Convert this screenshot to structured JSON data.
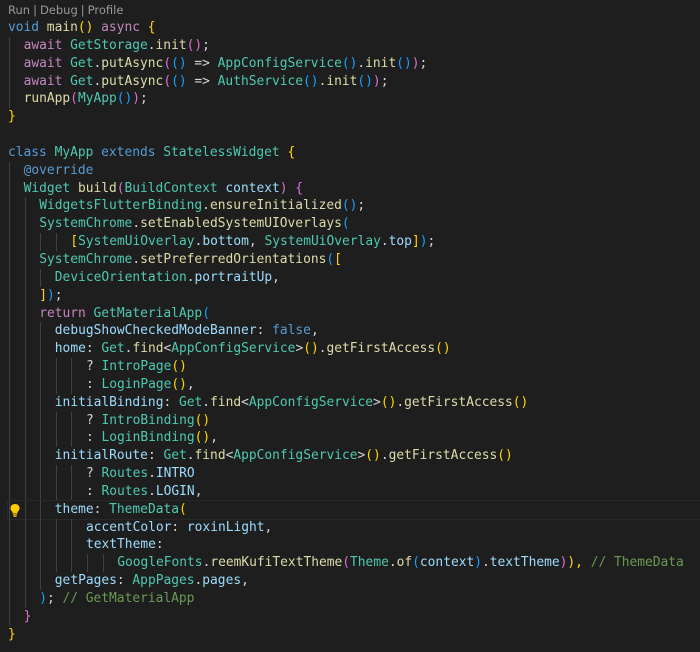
{
  "codelens": {
    "items": [
      "Run",
      "Debug",
      "Profile"
    ],
    "separator": "|"
  },
  "colors": {
    "background": "#1e1e1e",
    "keyword": "#569cd6",
    "control_keyword": "#c586c0",
    "function": "#dcdcaa",
    "type": "#4ec9b0",
    "variable": "#9cdcfe",
    "comment": "#6a9955",
    "bracket_gold": "#ffd700",
    "bracket_orchid": "#da70d6",
    "bracket_blue": "#179fff",
    "lightbulb": "#ffcc00"
  },
  "lightbulb_icon": "lightbulb-icon",
  "lightbulb_line": 28,
  "lines": [
    {
      "indent": 0,
      "tokens": [
        [
          "kw",
          "void"
        ],
        [
          "",
          ""
        ],
        [
          "fn",
          " main"
        ],
        [
          "br1",
          "()"
        ],
        [
          "op",
          " "
        ],
        [
          "ctl",
          "async"
        ],
        [
          "op",
          " "
        ],
        [
          "br1",
          "{"
        ]
      ]
    },
    {
      "indent": 1,
      "tokens": [
        [
          "ctl",
          "await"
        ],
        [
          "op",
          " "
        ],
        [
          "ty",
          "GetStorage"
        ],
        [
          "op",
          "."
        ],
        [
          "fn",
          "init"
        ],
        [
          "br2",
          "()"
        ],
        [
          "op",
          ";"
        ]
      ]
    },
    {
      "indent": 1,
      "tokens": [
        [
          "ctl",
          "await"
        ],
        [
          "op",
          " "
        ],
        [
          "ty",
          "Get"
        ],
        [
          "op",
          "."
        ],
        [
          "fn",
          "putAsync"
        ],
        [
          "br2",
          "("
        ],
        [
          "br3",
          "()"
        ],
        [
          "op",
          " => "
        ],
        [
          "ty",
          "AppConfigService"
        ],
        [
          "br3",
          "()"
        ],
        [
          "op",
          "."
        ],
        [
          "fn",
          "init"
        ],
        [
          "br3",
          "()"
        ],
        [
          "br2",
          ")"
        ],
        [
          "op",
          ";"
        ]
      ]
    },
    {
      "indent": 1,
      "tokens": [
        [
          "ctl",
          "await"
        ],
        [
          "op",
          " "
        ],
        [
          "ty",
          "Get"
        ],
        [
          "op",
          "."
        ],
        [
          "fn",
          "putAsync"
        ],
        [
          "br2",
          "("
        ],
        [
          "br3",
          "()"
        ],
        [
          "op",
          " => "
        ],
        [
          "ty",
          "AuthService"
        ],
        [
          "br3",
          "()"
        ],
        [
          "op",
          "."
        ],
        [
          "fn",
          "init"
        ],
        [
          "br3",
          "()"
        ],
        [
          "br2",
          ")"
        ],
        [
          "op",
          ";"
        ]
      ]
    },
    {
      "indent": 1,
      "tokens": [
        [
          "fn",
          "runApp"
        ],
        [
          "br2",
          "("
        ],
        [
          "ty",
          "MyApp"
        ],
        [
          "br3",
          "()"
        ],
        [
          "br2",
          ")"
        ],
        [
          "op",
          ";"
        ]
      ]
    },
    {
      "indent": 0,
      "tokens": [
        [
          "br1",
          "}"
        ]
      ]
    },
    {
      "indent": 0,
      "tokens": []
    },
    {
      "indent": 0,
      "tokens": [
        [
          "kw",
          "class"
        ],
        [
          "op",
          " "
        ],
        [
          "ty",
          "MyApp"
        ],
        [
          "op",
          " "
        ],
        [
          "kw",
          "extends"
        ],
        [
          "op",
          " "
        ],
        [
          "ty",
          "StatelessWidget"
        ],
        [
          "op",
          " "
        ],
        [
          "br1",
          "{"
        ]
      ]
    },
    {
      "indent": 1,
      "tokens": [
        [
          "kw",
          "@override"
        ]
      ]
    },
    {
      "indent": 1,
      "tokens": [
        [
          "ty",
          "Widget"
        ],
        [
          "op",
          " "
        ],
        [
          "fn",
          "build"
        ],
        [
          "br2",
          "("
        ],
        [
          "ty",
          "BuildContext"
        ],
        [
          "op",
          " "
        ],
        [
          "var",
          "context"
        ],
        [
          "br2",
          ")"
        ],
        [
          "op",
          " "
        ],
        [
          "br2",
          "{"
        ]
      ]
    },
    {
      "indent": 2,
      "tokens": [
        [
          "ty",
          "WidgetsFlutterBinding"
        ],
        [
          "op",
          "."
        ],
        [
          "fn",
          "ensureInitialized"
        ],
        [
          "br3",
          "()"
        ],
        [
          "op",
          ";"
        ]
      ]
    },
    {
      "indent": 2,
      "tokens": [
        [
          "ty",
          "SystemChrome"
        ],
        [
          "op",
          "."
        ],
        [
          "fn",
          "setEnabledSystemUIOverlays"
        ],
        [
          "br3",
          "("
        ]
      ]
    },
    {
      "indent": 4,
      "tokens": [
        [
          "br1",
          "["
        ],
        [
          "ty",
          "SystemUiOverlay"
        ],
        [
          "op",
          "."
        ],
        [
          "var",
          "bottom"
        ],
        [
          "op",
          ", "
        ],
        [
          "ty",
          "SystemUiOverlay"
        ],
        [
          "op",
          "."
        ],
        [
          "var",
          "top"
        ],
        [
          "br1",
          "]"
        ],
        [
          "br3",
          ")"
        ],
        [
          "op",
          ";"
        ]
      ]
    },
    {
      "indent": 2,
      "tokens": [
        [
          "ty",
          "SystemChrome"
        ],
        [
          "op",
          "."
        ],
        [
          "fn",
          "setPreferredOrientations"
        ],
        [
          "br3",
          "("
        ],
        [
          "br1",
          "["
        ]
      ]
    },
    {
      "indent": 3,
      "tokens": [
        [
          "ty",
          "DeviceOrientation"
        ],
        [
          "op",
          "."
        ],
        [
          "var",
          "portraitUp"
        ],
        [
          "op",
          ","
        ]
      ]
    },
    {
      "indent": 2,
      "tokens": [
        [
          "br1",
          "]"
        ],
        [
          "br3",
          ")"
        ],
        [
          "op",
          ";"
        ]
      ]
    },
    {
      "indent": 2,
      "tokens": [
        [
          "ctl",
          "return"
        ],
        [
          "op",
          " "
        ],
        [
          "ty",
          "GetMaterialApp"
        ],
        [
          "br3",
          "("
        ]
      ]
    },
    {
      "indent": 3,
      "tokens": [
        [
          "var",
          "debugShowCheckedModeBanner"
        ],
        [
          "op",
          ": "
        ],
        [
          "kw",
          "false"
        ],
        [
          "op",
          ","
        ]
      ]
    },
    {
      "indent": 3,
      "tokens": [
        [
          "var",
          "home"
        ],
        [
          "op",
          ": "
        ],
        [
          "ty",
          "Get"
        ],
        [
          "op",
          "."
        ],
        [
          "fn",
          "find"
        ],
        [
          "op",
          "<"
        ],
        [
          "ty",
          "AppConfigService"
        ],
        [
          "op",
          ">"
        ],
        [
          "br1",
          "()"
        ],
        [
          "op",
          "."
        ],
        [
          "fn",
          "getFirstAccess"
        ],
        [
          "br1",
          "()"
        ]
      ]
    },
    {
      "indent": 5,
      "tokens": [
        [
          "op",
          "? "
        ],
        [
          "ty",
          "IntroPage"
        ],
        [
          "br1",
          "()"
        ]
      ]
    },
    {
      "indent": 5,
      "tokens": [
        [
          "op",
          ": "
        ],
        [
          "ty",
          "LoginPage"
        ],
        [
          "br1",
          "()"
        ],
        [
          "op",
          ","
        ]
      ]
    },
    {
      "indent": 3,
      "tokens": [
        [
          "var",
          "initialBinding"
        ],
        [
          "op",
          ": "
        ],
        [
          "ty",
          "Get"
        ],
        [
          "op",
          "."
        ],
        [
          "fn",
          "find"
        ],
        [
          "op",
          "<"
        ],
        [
          "ty",
          "AppConfigService"
        ],
        [
          "op",
          ">"
        ],
        [
          "br1",
          "()"
        ],
        [
          "op",
          "."
        ],
        [
          "fn",
          "getFirstAccess"
        ],
        [
          "br1",
          "()"
        ]
      ]
    },
    {
      "indent": 5,
      "tokens": [
        [
          "op",
          "? "
        ],
        [
          "ty",
          "IntroBinding"
        ],
        [
          "br1",
          "()"
        ]
      ]
    },
    {
      "indent": 5,
      "tokens": [
        [
          "op",
          ": "
        ],
        [
          "ty",
          "LoginBinding"
        ],
        [
          "br1",
          "()"
        ],
        [
          "op",
          ","
        ]
      ]
    },
    {
      "indent": 3,
      "tokens": [
        [
          "var",
          "initialRoute"
        ],
        [
          "op",
          ": "
        ],
        [
          "ty",
          "Get"
        ],
        [
          "op",
          "."
        ],
        [
          "fn",
          "find"
        ],
        [
          "op",
          "<"
        ],
        [
          "ty",
          "AppConfigService"
        ],
        [
          "op",
          ">"
        ],
        [
          "br1",
          "()"
        ],
        [
          "op",
          "."
        ],
        [
          "fn",
          "getFirstAccess"
        ],
        [
          "br1",
          "()"
        ]
      ]
    },
    {
      "indent": 5,
      "tokens": [
        [
          "op",
          "? "
        ],
        [
          "ty",
          "Routes"
        ],
        [
          "op",
          "."
        ],
        [
          "var",
          "INTRO"
        ]
      ]
    },
    {
      "indent": 5,
      "tokens": [
        [
          "op",
          ": "
        ],
        [
          "ty",
          "Routes"
        ],
        [
          "op",
          "."
        ],
        [
          "var",
          "LOGIN"
        ],
        [
          "op",
          ","
        ]
      ]
    },
    {
      "indent": 3,
      "tokens": [
        [
          "var",
          "theme"
        ],
        [
          "op",
          ": "
        ],
        [
          "ty",
          "ThemeData"
        ],
        [
          "br1",
          "("
        ]
      ],
      "current": true
    },
    {
      "indent": 5,
      "tokens": [
        [
          "var",
          "accentColor"
        ],
        [
          "op",
          ": "
        ],
        [
          "var",
          "roxinLight"
        ],
        [
          "op",
          ","
        ]
      ]
    },
    {
      "indent": 5,
      "tokens": [
        [
          "var",
          "textTheme"
        ],
        [
          "op",
          ":"
        ]
      ]
    },
    {
      "indent": 7,
      "tokens": [
        [
          "ty",
          "GoogleFonts"
        ],
        [
          "op",
          "."
        ],
        [
          "fn",
          "reemKufiTextTheme"
        ],
        [
          "br2",
          "("
        ],
        [
          "ty",
          "Theme"
        ],
        [
          "op",
          "."
        ],
        [
          "fn",
          "of"
        ],
        [
          "br3",
          "("
        ],
        [
          "var",
          "context"
        ],
        [
          "br3",
          ")"
        ],
        [
          "op",
          "."
        ],
        [
          "var",
          "textTheme"
        ],
        [
          "br2",
          ")"
        ],
        [
          "br1",
          "),"
        ],
        [
          "op",
          " "
        ],
        [
          "cm",
          "// ThemeData"
        ]
      ]
    },
    {
      "indent": 3,
      "tokens": [
        [
          "var",
          "getPages"
        ],
        [
          "op",
          ": "
        ],
        [
          "ty",
          "AppPages"
        ],
        [
          "op",
          "."
        ],
        [
          "var",
          "pages"
        ],
        [
          "op",
          ","
        ]
      ]
    },
    {
      "indent": 2,
      "tokens": [
        [
          "br3",
          ")"
        ],
        [
          "op",
          "; "
        ],
        [
          "cm",
          "// GetMaterialApp"
        ]
      ]
    },
    {
      "indent": 1,
      "tokens": [
        [
          "br2",
          "}"
        ]
      ]
    },
    {
      "indent": 0,
      "tokens": [
        [
          "br1",
          "}"
        ]
      ]
    }
  ]
}
